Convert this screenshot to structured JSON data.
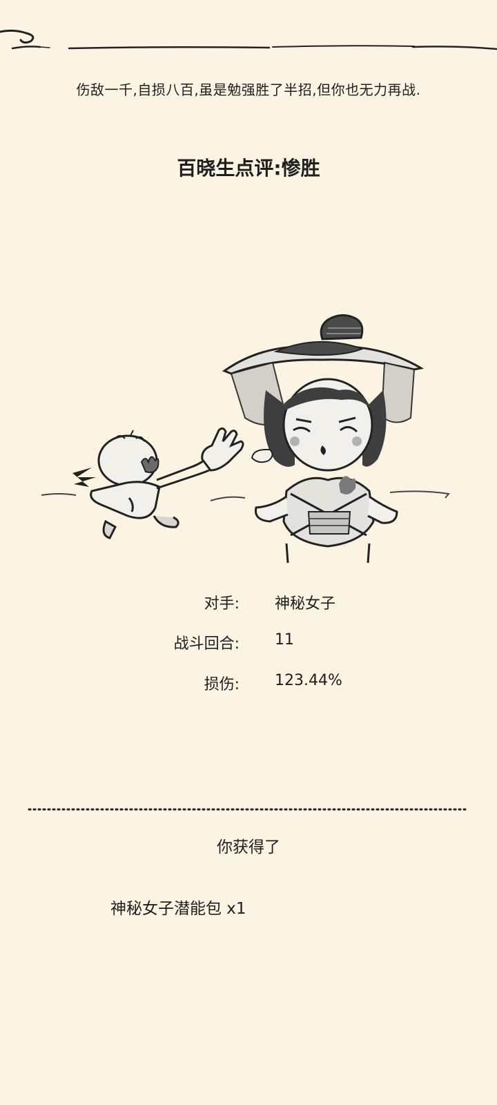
{
  "battle_result": {
    "narration": "伤敌一千,自损八百,虽是勉强胜了半招,但你也无力再战.",
    "rating": "百晓生点评:惨胜"
  },
  "stats": [
    {
      "label": "对手:",
      "value": "神秘女子"
    },
    {
      "label": "战斗回合:",
      "value": "11"
    },
    {
      "label": "损伤:",
      "value": "123.44%"
    }
  ],
  "rewards": {
    "heading": "你获得了",
    "items": [
      {
        "label": "神秘女子潜能包 x1"
      }
    ]
  }
}
